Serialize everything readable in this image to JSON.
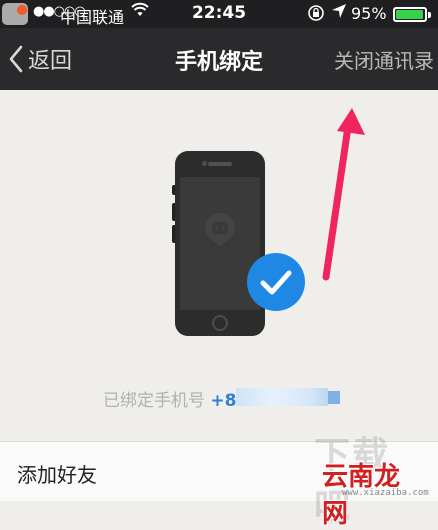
{
  "status_bar": {
    "signal_dots": "●●○○○",
    "carrier": "中国联通",
    "time": "22:45",
    "battery_percent": "95%",
    "battery_level": 0.95,
    "battery_color": "#37d24a"
  },
  "nav": {
    "back_label": "返回",
    "title": "手机绑定",
    "right_action": "关闭通讯录"
  },
  "illustration": {
    "check_color": "#1f88e5"
  },
  "bound": {
    "label": "已绑定手机号",
    "number_visible": "+86"
  },
  "list": {
    "add_friend": "添加好友"
  },
  "watermark": {
    "big": "下载吧",
    "brand": "云南龙网",
    "url": "www.xiazaiba.com"
  },
  "colors": {
    "nav_bg": "#2a2a2c",
    "page_bg": "#efeeeb",
    "arrow": "#f0245e",
    "link_blue": "#2f7fd6"
  }
}
